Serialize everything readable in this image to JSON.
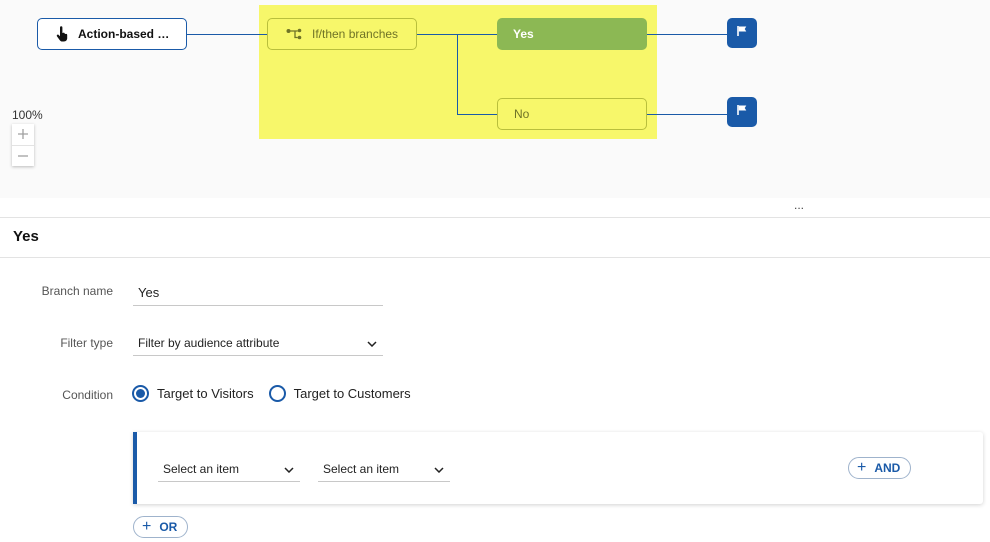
{
  "canvas": {
    "zoom_label": "100%",
    "zoom_in_icon": "plus-icon",
    "zoom_out_icon": "minus-icon",
    "nodes": {
      "action": {
        "label": "Action-based …",
        "icon": "hand-pointer-icon"
      },
      "ifthen": {
        "label": "If/then branches",
        "icon": "branch-icon"
      },
      "yes": {
        "label": "Yes"
      },
      "no": {
        "label": "No"
      }
    },
    "end_icon": "flag-icon",
    "splitter_dots": "...",
    "colors": {
      "accent": "#1a5aa8",
      "highlight": "#f7f76a",
      "yes_node": "#8cb854"
    }
  },
  "panel": {
    "title": "Yes",
    "branch_name_label": "Branch name",
    "branch_name_value": "Yes",
    "filter_type_label": "Filter type",
    "filter_type_value": "Filter by audience attribute",
    "condition_label": "Condition",
    "radio_options": [
      {
        "label": "Target to Visitors",
        "selected": true
      },
      {
        "label": "Target to Customers",
        "selected": false
      }
    ],
    "condition_row": {
      "select1": "Select an item",
      "select2": "Select an item",
      "and_label": "AND"
    },
    "or_label": "OR"
  }
}
